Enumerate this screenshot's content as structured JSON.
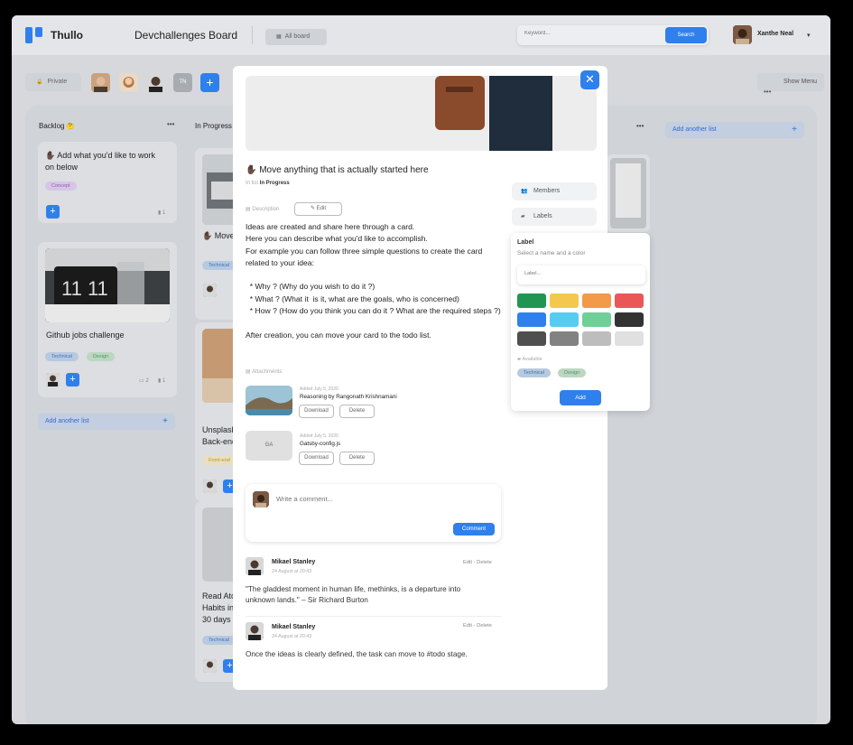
{
  "app": {
    "name": "Thullo",
    "board_title": "Devchallenges Board",
    "all_board_label": "All board"
  },
  "search": {
    "placeholder": "Keyword...",
    "button": "Search"
  },
  "user": {
    "name": "Xanthe Neal"
  },
  "board_bar": {
    "visibility": "Private",
    "member_initials": "TN",
    "show_menu": "Show Menu"
  },
  "lists": [
    {
      "title": "Backlog",
      "emoji": "🤔",
      "cards": [
        {
          "title": "✋🏿 Add what you'd like to work on below",
          "tags": [
            "Concept"
          ],
          "attachments": "1"
        },
        {
          "title": "Github jobs challenge",
          "tags": [
            "Technical",
            "Design"
          ],
          "comments": "2",
          "attachments": "1"
        }
      ],
      "add_label": "Add another list"
    },
    {
      "title": "In Progress",
      "cards": [
        {
          "title": "✋🏿 Move anything that is actually started here",
          "tags": [
            "Technical"
          ]
        },
        {
          "title": "Unsplash Back-end",
          "tags": [
            "Front-end"
          ]
        },
        {
          "title": "Read Atomic Habits in next 30 days",
          "tags": [
            "Technical"
          ]
        }
      ]
    }
  ],
  "add_another_list": "Add another list",
  "modal": {
    "title": "✋🏿 Move anything that is actually started here",
    "in_list_prefix": "In list",
    "in_list_name": "In Progress",
    "description_label": "Description",
    "edit_label": "Edit",
    "description": "Ideas are created and share here through a card.\nHere you can describe what you'd like to accomplish.\nFor example you can follow three simple questions to create the card related to your idea:\n\n  * Why ? (Why do you wish to do it ?)\n  * What ? (What it  is it, what are the goals, who is concerned)\n  * How ? (How do you think you can do it ? What are the required steps ?)\n\nAfter creation, you can move your card to the todo list.",
    "attachments_label": "Attachments",
    "attachments": [
      {
        "added": "Added July 5, 2020",
        "name": "Reasoning by Rangonath Krishnamani",
        "download": "Download",
        "delete": "Delete"
      },
      {
        "added": "Added July 5, 2020",
        "name": "Gatsby-config.js",
        "thumb": "GA",
        "download": "Download",
        "delete": "Delete"
      }
    ],
    "comment_placeholder": "Write a comment...",
    "comment_button": "Comment",
    "comments": [
      {
        "author": "Mikael Stanley",
        "date": "24 August at 20:43",
        "actions": "Edit  -  Delete",
        "text": "\"The gladdest moment in human life, methinks, is a departure into unknown lands.\" – Sir Richard Burton"
      },
      {
        "author": "Mikael Stanley",
        "date": "24 August at 20:43",
        "actions": "Edit  -  Delete",
        "text": "Once the ideas is clearly defined, the task can move to #todo stage."
      }
    ],
    "members_label": "Members",
    "labels_label": "Labels"
  },
  "label_popover": {
    "title": "Label",
    "subtitle": "Select a name and a color",
    "placeholder": "Label...",
    "colors": [
      "#219653",
      "#F2C94C",
      "#F2994A",
      "#EB5757",
      "#2F80ED",
      "#56CCF2",
      "#6FCF97",
      "#333333",
      "#4F4F4F",
      "#828282",
      "#BDBDBD",
      "#E0E0E0"
    ],
    "available_label": "Available",
    "available": [
      "Technical",
      "Design"
    ],
    "add_button": "Add"
  }
}
